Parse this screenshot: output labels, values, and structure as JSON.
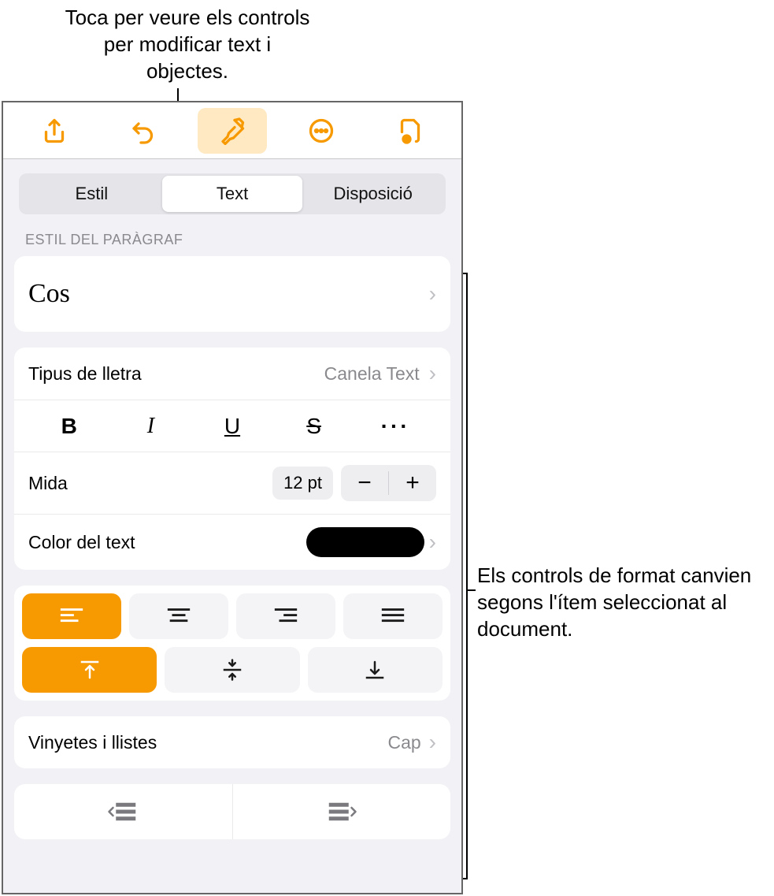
{
  "callouts": {
    "top": "Toca per veure els controls per modificar text i objectes.",
    "right": "Els controls de format canvien segons l'ítem seleccionat al document."
  },
  "toolbar": {
    "icons": [
      "share",
      "undo",
      "format",
      "more",
      "document"
    ],
    "active": "format"
  },
  "tabs": {
    "items": [
      "Estil",
      "Text",
      "Disposició"
    ],
    "active": 1
  },
  "sections": {
    "paragraph_header": "Estil del paràgraf",
    "paragraph_style": "Cos",
    "font_label": "Tipus de lletra",
    "font_value": "Canela Text",
    "style_buttons": {
      "bold": "B",
      "italic": "I",
      "underline": "U",
      "strike": "S",
      "more": "···"
    },
    "size_label": "Mida",
    "size_value": "12 pt",
    "color_label": "Color del text",
    "color_value": "#000000",
    "bullets_label": "Vinyetes i llistes",
    "bullets_value": "Cap"
  }
}
